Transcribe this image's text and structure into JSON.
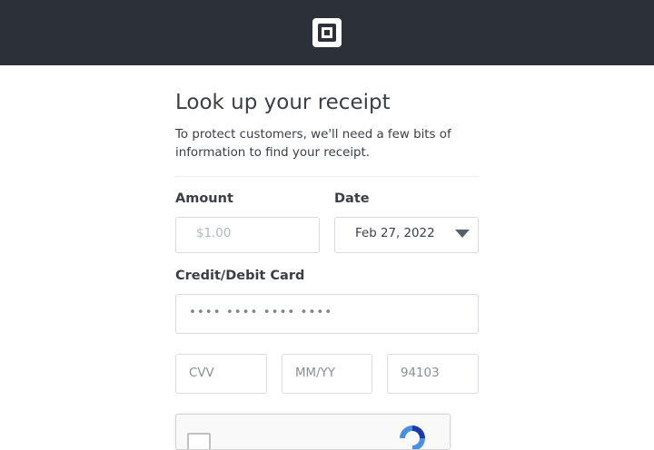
{
  "header": {
    "logo_icon": "square-logo-icon",
    "background_color": "#2c3039"
  },
  "page": {
    "title": "Look up your receipt",
    "subtitle": "To protect customers, we'll need a few bits of information to find your receipt."
  },
  "form": {
    "amount": {
      "label": "Amount",
      "placeholder": "$1.00",
      "value": ""
    },
    "date": {
      "label": "Date",
      "value": "Feb 27, 2022",
      "icon": "chevron-down-icon"
    },
    "card": {
      "label": "Credit/Debit Card",
      "placeholder": "•••• •••• •••• ••••"
    },
    "cvv": {
      "placeholder": "CVV"
    },
    "expiry": {
      "placeholder": "MM/YY"
    },
    "zip": {
      "placeholder": "94103"
    }
  },
  "captcha": {
    "icon": "recaptcha-icon",
    "checked": false
  }
}
